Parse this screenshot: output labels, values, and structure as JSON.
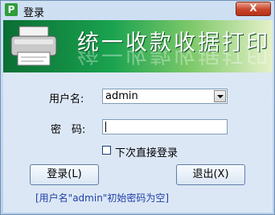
{
  "window": {
    "title": "登录",
    "app_icon_letter": "P",
    "close_label": "X"
  },
  "banner": {
    "text": "统一收款收据打印",
    "icon": "printer-icon"
  },
  "form": {
    "username_label": "用户名:",
    "username_value": "admin",
    "password_label": "密　码:",
    "password_value": "",
    "checkbox_label": "下次直接登录",
    "checkbox_checked": false,
    "login_button": "登录(L)",
    "exit_button": "退出(X)",
    "hint": "[用户名\"admin\"初始密码为空]"
  },
  "colors": {
    "hint": "#1f3fa6",
    "close_button": "#c7442b",
    "banner_green": "#0a6e33"
  }
}
